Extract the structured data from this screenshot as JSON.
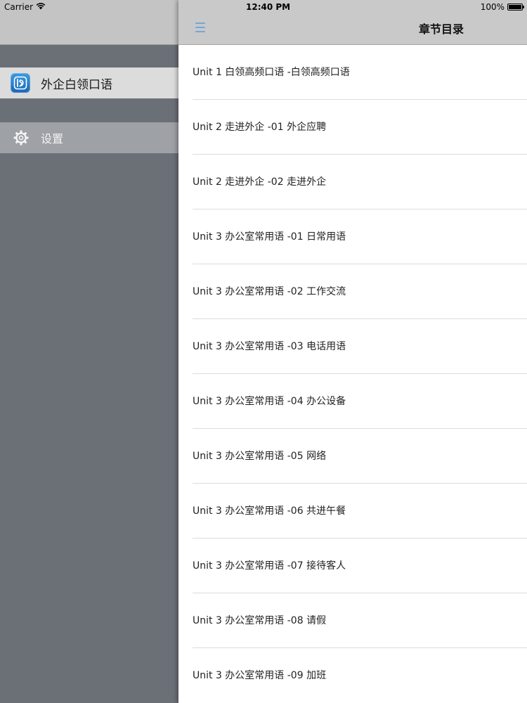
{
  "status_bar": {
    "carrier": "Carrier",
    "time": "12:40 PM",
    "battery_text": "100%",
    "battery_level": 1.0
  },
  "side_menu": {
    "app_item": {
      "label": "外企白领口语",
      "icon": "app-logo-icon"
    },
    "settings_item": {
      "label": "设置",
      "icon": "gear-icon"
    }
  },
  "nav_bar": {
    "title": "章节目录",
    "menu_icon": "hamburger-icon",
    "accent_color": "#74a6d9"
  },
  "chapters": [
    "Unit 1 白领高频口语 -白领高频口语",
    "Unit 2 走进外企 -01 外企应聘",
    "Unit 2 走进外企 -02 走进外企",
    "Unit 3 办公室常用语 -01 日常用语",
    "Unit 3 办公室常用语 -02 工作交流",
    "Unit 3 办公室常用语 -03 电话用语",
    "Unit 3 办公室常用语 -04 办公设备",
    "Unit 3 办公室常用语 -05 网络",
    "Unit 3 办公室常用语 -06 共进午餐",
    "Unit 3 办公室常用语 -07 接待客人",
    "Unit 3 办公室常用语 -08 请假",
    "Unit 3 办公室常用语 -09 加班"
  ]
}
